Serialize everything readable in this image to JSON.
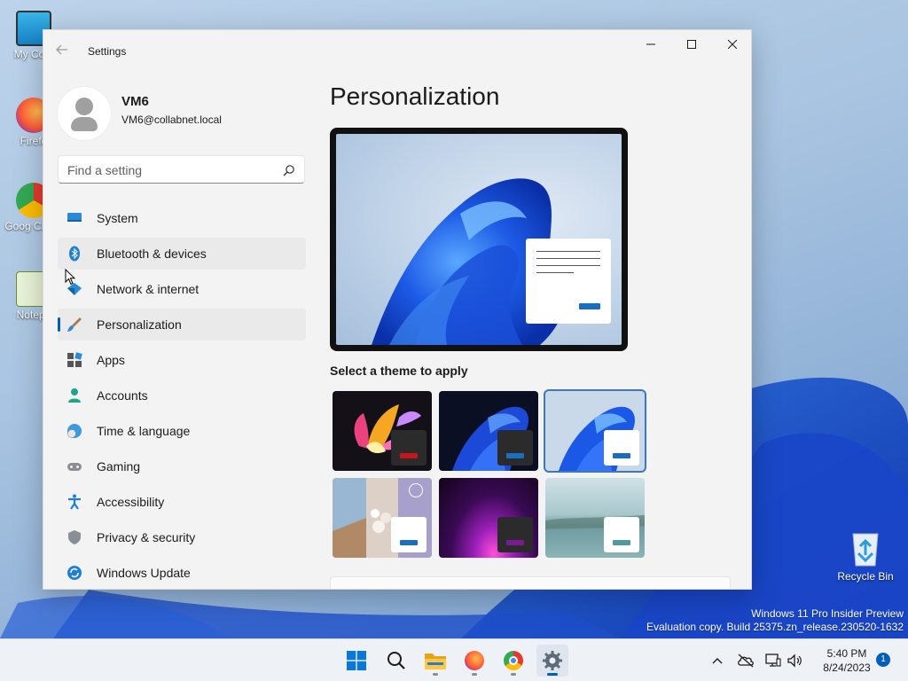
{
  "desktop": {
    "icons": [
      {
        "label": "My Com"
      },
      {
        "label": "Firefo"
      },
      {
        "label": "Goog Chron"
      },
      {
        "label": "Notepa"
      }
    ],
    "recycle_bin": "Recycle Bin",
    "watermark": {
      "line1": "Windows 11 Pro Insider Preview",
      "line2": "Evaluation copy. Build 25375.zn_release.230520-1632"
    }
  },
  "window": {
    "title": "Settings",
    "controls": {
      "minimize": "minimize-icon",
      "maximize": "maximize-icon",
      "close": "close-icon"
    }
  },
  "profile": {
    "name": "VM6",
    "email": "VM6@collabnet.local"
  },
  "search": {
    "placeholder": "Find a setting"
  },
  "nav": {
    "items": [
      {
        "label": "System",
        "icon": "system-icon"
      },
      {
        "label": "Bluetooth & devices",
        "icon": "bluetooth-icon"
      },
      {
        "label": "Network & internet",
        "icon": "network-icon"
      },
      {
        "label": "Personalization",
        "icon": "personalization-icon"
      },
      {
        "label": "Apps",
        "icon": "apps-icon"
      },
      {
        "label": "Accounts",
        "icon": "accounts-icon"
      },
      {
        "label": "Time & language",
        "icon": "time-language-icon"
      },
      {
        "label": "Gaming",
        "icon": "gaming-icon"
      },
      {
        "label": "Accessibility",
        "icon": "accessibility-icon"
      },
      {
        "label": "Privacy & security",
        "icon": "privacy-icon"
      },
      {
        "label": "Windows Update",
        "icon": "windows-update-icon"
      }
    ],
    "selected": "Personalization",
    "hovered": "Bluetooth & devices"
  },
  "main": {
    "title": "Personalization",
    "theme_section_label": "Select a theme to apply",
    "themes": [
      {
        "name": "theme-glow",
        "accent": "#c4161c"
      },
      {
        "name": "theme-windows-dark",
        "accent": "#1a6ec0"
      },
      {
        "name": "theme-windows-light",
        "accent": "#1a6ec0",
        "selected": true
      },
      {
        "name": "theme-spotlight",
        "accent": "#1a6ec0"
      },
      {
        "name": "theme-captured-motion",
        "accent": "#7a1a90"
      },
      {
        "name": "theme-flow",
        "accent": "#4f9aa0"
      }
    ]
  },
  "taskbar": {
    "apps": [
      {
        "name": "start-button",
        "icon": "windows-logo-icon"
      },
      {
        "name": "search-button",
        "icon": "search-icon"
      },
      {
        "name": "file-explorer-button",
        "icon": "folder-icon"
      },
      {
        "name": "firefox-button",
        "icon": "firefox-icon"
      },
      {
        "name": "chrome-button",
        "icon": "chrome-icon"
      },
      {
        "name": "settings-button",
        "icon": "gear-icon",
        "active": true
      }
    ],
    "clock": {
      "time": "5:40 PM",
      "date": "8/24/2023"
    },
    "notification_count": "1"
  },
  "colors": {
    "accent": "#005fb8",
    "window_bg": "#f3f3f3"
  }
}
